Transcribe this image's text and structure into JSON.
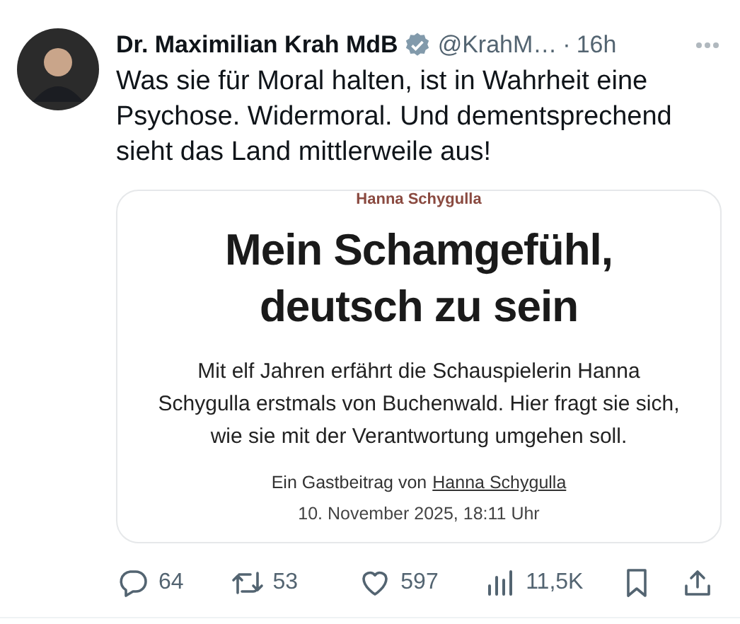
{
  "author": {
    "name": "Dr. Maximilian Krah MdB",
    "verified": true,
    "handle": "@KrahM…",
    "separator": "·",
    "time": "16h"
  },
  "text": "Was sie für Moral halten, ist in Wahrheit eine Psychose. Widermoral. Und dementsprechend sieht das Land mittlerweile aus!",
  "card": {
    "kicker": "Hanna Schygulla",
    "headline": "Mein Schamgefühl, deutsch zu sein",
    "teaser": "Mit elf Jahren erfährt die Schauspielerin Hanna Schygulla erstmals von Buchenwald. Hier fragt sie sich, wie sie mit der Verantwortung umgehen soll.",
    "byline_prefix": "Ein Gastbeitrag von",
    "byline_author": "Hanna Schygulla",
    "date": "10. November 2025, 18:11 Uhr"
  },
  "actions": [
    {
      "kind": "reply",
      "count": "64"
    },
    {
      "kind": "repost",
      "count": "53"
    },
    {
      "kind": "like",
      "count": "597"
    },
    {
      "kind": "views",
      "count": "11,5K"
    },
    {
      "kind": "bookmark"
    },
    {
      "kind": "share"
    }
  ]
}
